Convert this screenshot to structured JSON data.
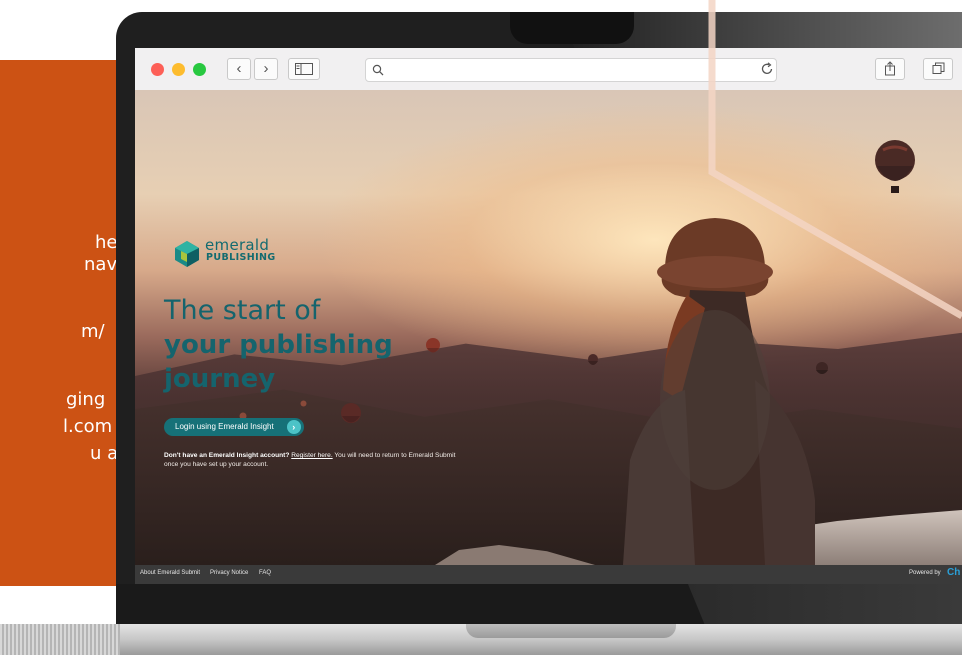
{
  "background_panel": {
    "lines": [
      "he",
      "nave",
      "m/",
      "ging",
      "l.com",
      "u as"
    ]
  },
  "browser": {
    "back_label": "‹",
    "forward_label": "›",
    "search_icon": "search-icon",
    "reload_icon": "reload-icon",
    "share_icon": "share-icon",
    "tabs_icon": "tabs-icon"
  },
  "page": {
    "logo": {
      "word1": "emerald",
      "word2": "PUBLISHING"
    },
    "headline": {
      "line1": "The start of",
      "line2": "your publishing",
      "line3": "journey"
    },
    "login_button": "Login using Emerald Insight",
    "login_arrow": "›",
    "register_note": {
      "bold": "Don't have an Emerald Insight account?",
      "link": "Register here.",
      "rest": "You will need to return to Emerald Submit",
      "line2": "once you have set up your account."
    }
  },
  "footer": {
    "links": [
      "About Emerald Submit",
      "Privacy Notice",
      "FAQ"
    ],
    "powered_by": "Powered by",
    "brand": "Ch"
  },
  "colors": {
    "accent_orange": "#cc5214",
    "brand_teal": "#15646d",
    "button_teal": "#167178"
  }
}
